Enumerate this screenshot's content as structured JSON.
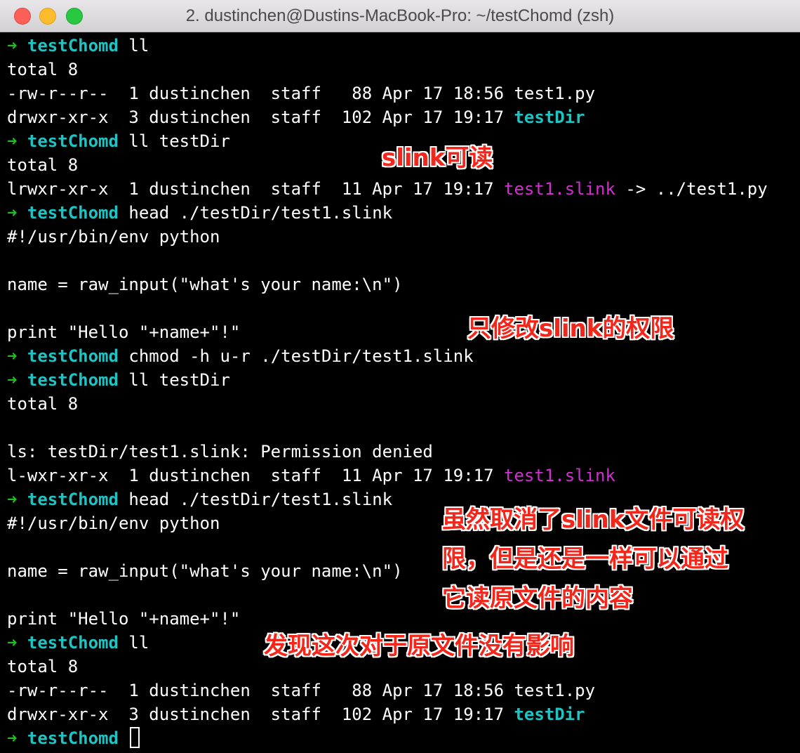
{
  "window": {
    "title": "2. dustinchen@Dustins-MacBook-Pro: ~/testChomd (zsh)"
  },
  "terminal": {
    "prompt_arrow": "➜",
    "prompt_dir": "testChomd",
    "lines": [
      {
        "type": "prompt",
        "cmd": "ll"
      },
      {
        "type": "text",
        "text": "total 8"
      },
      {
        "type": "file",
        "text": "-rw-r--r--  1 dustinchen  staff   88 Apr 17 18:56 test1.py"
      },
      {
        "type": "dirent",
        "pre": "drwxr-xr-x  3 dustinchen  staff  102 Apr 17 19:17 ",
        "name": "testDir"
      },
      {
        "type": "prompt",
        "cmd": "ll testDir"
      },
      {
        "type": "text",
        "text": "total 8"
      },
      {
        "type": "linkent",
        "pre": "lrwxr-xr-x  1 dustinchen  staff  11 Apr 17 19:17 ",
        "name": "test1.slink",
        "post": " -> ../test1.py"
      },
      {
        "type": "prompt",
        "cmd": "head ./testDir/test1.slink"
      },
      {
        "type": "text",
        "text": "#!/usr/bin/env python"
      },
      {
        "type": "text",
        "text": ""
      },
      {
        "type": "text",
        "text": "name = raw_input(\"what's your name:\\n\")"
      },
      {
        "type": "text",
        "text": ""
      },
      {
        "type": "text",
        "text": "print \"Hello \"+name+\"!\""
      },
      {
        "type": "prompt",
        "cmd": "chmod -h u-r ./testDir/test1.slink"
      },
      {
        "type": "prompt",
        "cmd": "ll testDir"
      },
      {
        "type": "text",
        "text": "total 8"
      },
      {
        "type": "text",
        "text": ""
      },
      {
        "type": "text",
        "text": "ls: testDir/test1.slink: Permission denied"
      },
      {
        "type": "linkent",
        "pre": "l-wxr-xr-x  1 dustinchen  staff  11 Apr 17 19:17 ",
        "name": "test1.slink",
        "post": ""
      },
      {
        "type": "prompt",
        "cmd": "head ./testDir/test1.slink"
      },
      {
        "type": "text",
        "text": "#!/usr/bin/env python"
      },
      {
        "type": "text",
        "text": ""
      },
      {
        "type": "text",
        "text": "name = raw_input(\"what's your name:\\n\")"
      },
      {
        "type": "text",
        "text": ""
      },
      {
        "type": "text",
        "text": "print \"Hello \"+name+\"!\""
      },
      {
        "type": "prompt",
        "cmd": "ll"
      },
      {
        "type": "text",
        "text": "total 8"
      },
      {
        "type": "file",
        "text": "-rw-r--r--  1 dustinchen  staff   88 Apr 17 18:56 test1.py"
      },
      {
        "type": "dirent",
        "pre": "drwxr-xr-x  3 dustinchen  staff  102 Apr 17 19:17 ",
        "name": "testDir"
      },
      {
        "type": "cursor",
        "cmd": ""
      }
    ]
  },
  "annotations": {
    "slink_readable": "slink可读",
    "only_modify": "只修改slink的权限",
    "still_readable": "虽然取消了slink文件可读权\n限，但是还是一样可以通过\n它读原文件的内容",
    "no_effect": "发现这次对于原文件没有影响"
  },
  "colors": {
    "prompt_arrow": "#1ec11e",
    "directory": "#1fc3c3",
    "symlink": "#d12fd1",
    "annotation": "#f3261b"
  }
}
